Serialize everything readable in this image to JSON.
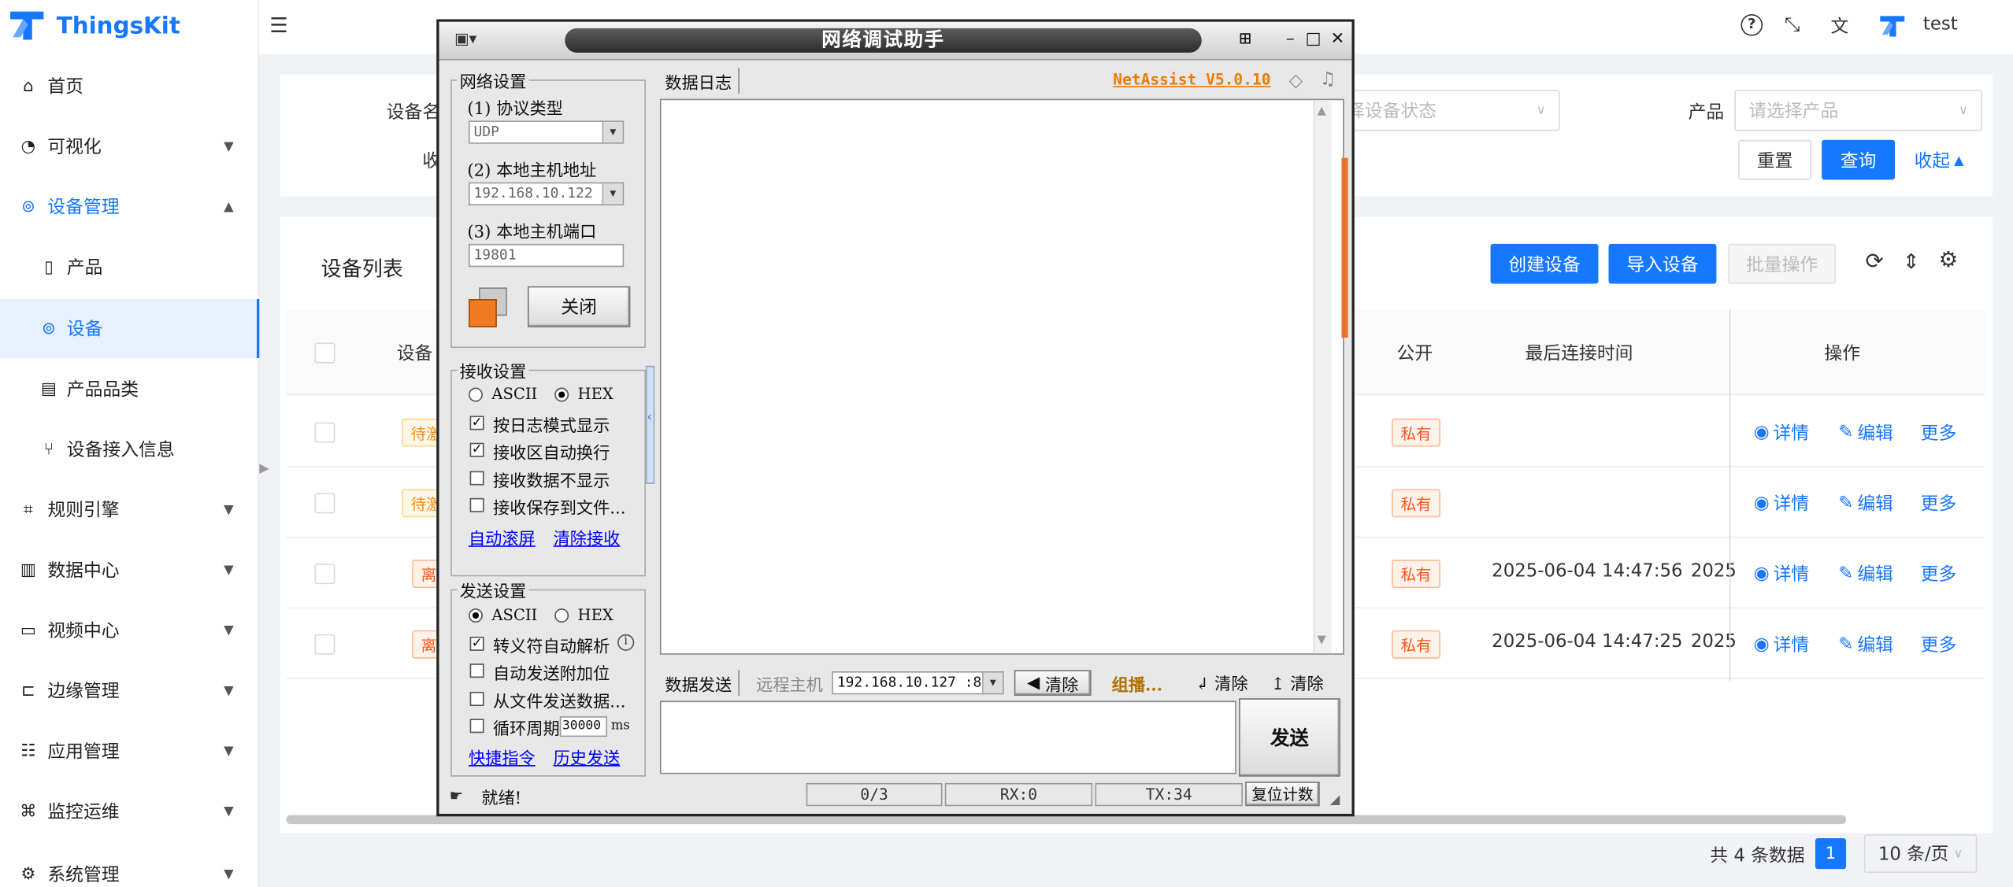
{
  "app": {
    "name": "ThingsKit",
    "user": "test"
  },
  "sidebar": {
    "items": [
      {
        "label": "首页"
      },
      {
        "label": "可视化"
      },
      {
        "label": "设备管理"
      },
      {
        "label": "产品"
      },
      {
        "label": "设备"
      },
      {
        "label": "产品品类"
      },
      {
        "label": "设备接入信息"
      },
      {
        "label": "规则引擎"
      },
      {
        "label": "数据中心"
      },
      {
        "label": "视频中心"
      },
      {
        "label": "边缘管理"
      },
      {
        "label": "应用管理"
      },
      {
        "label": "监控运维"
      },
      {
        "label": "系统管理"
      }
    ]
  },
  "search": {
    "device_name_label": "设备名",
    "collect_label": "收",
    "status_placeholder": "择设备状态",
    "product_label": "产品",
    "product_placeholder": "请选择产品",
    "reset_label": "重置",
    "query_label": "查询",
    "collapse_label": "收起"
  },
  "list": {
    "title": "设备列表",
    "create_label": "创建设备",
    "import_label": "导入设备",
    "batch_label": "批量操作",
    "columns": {
      "device": "设备",
      "public": "公开",
      "last_connect": "最后连接时间",
      "actions": "操作"
    },
    "rows": [
      {
        "status": "待激",
        "public": "私有",
        "last_connect": "",
        "other": ""
      },
      {
        "status": "待激",
        "public": "私有",
        "last_connect": "",
        "other": ""
      },
      {
        "status": "离",
        "public": "私有",
        "last_connect": "2025-06-04 14:47:56",
        "other": "2025"
      },
      {
        "status": "离",
        "public": "私有",
        "last_connect": "2025-06-04 14:47:25",
        "other": "2025"
      }
    ],
    "action_detail": "详情",
    "action_edit": "编辑",
    "action_more": "更多",
    "total_text": "共 4 条数据",
    "current_page": "1",
    "page_size": "10 条/页"
  },
  "netassist": {
    "title": "网络调试助手",
    "version": "NetAssist V5.0.10",
    "network_group": "网络设置",
    "protocol_label": "(1) 协议类型",
    "protocol_value": "UDP",
    "host_label": "(2) 本地主机地址",
    "host_value": "192.168.10.122",
    "port_label": "(3) 本地主机端口",
    "port_value": "19801",
    "close_label": "关闭",
    "recv_group": "接收设置",
    "recv_ascii": "ASCII",
    "recv_hex": "HEX",
    "recv_opt1": "按日志模式显示",
    "recv_opt2": "接收区自动换行",
    "recv_opt3": "接收数据不显示",
    "recv_opt4": "接收保存到文件...",
    "auto_scroll": "自动滚屏",
    "clear_recv": "清除接收",
    "send_group": "发送设置",
    "send_ascii": "ASCII",
    "send_hex": "HEX",
    "send_opt1": "转义符自动解析",
    "send_opt2": "自动发送附加位",
    "send_opt3": "从文件发送数据...",
    "send_opt4": "循环周期",
    "cycle_value": "30000",
    "cycle_unit": "ms",
    "quick_cmd": "快捷指令",
    "history_send": "历史发送",
    "log_tab": "数据日志",
    "send_tab": "数据发送",
    "remote_host_label": "远程主机",
    "remote_host_value": "192.168.10.127 :8(",
    "clear_label": "清除",
    "group_label": "组播...",
    "clear2": "清除",
    "clear3": "清除",
    "send_btn": "发送",
    "status_ready": "就绪!",
    "counter": "0/3",
    "rx": "RX:0",
    "tx": "TX:34",
    "reset_count": "复位计数"
  }
}
